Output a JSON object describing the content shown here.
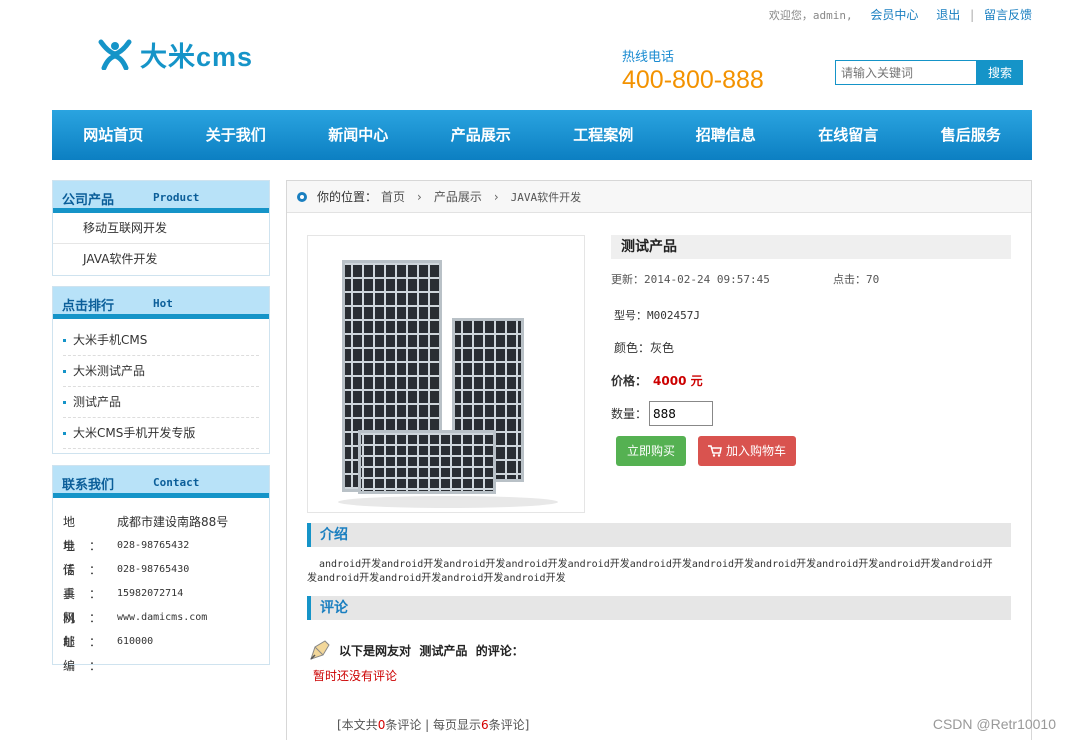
{
  "header": {
    "welcome": "欢迎您，admin,",
    "member_center": "会员中心",
    "logout": "退出",
    "separator": "|",
    "feedback": "留言反馈",
    "logo_text": "大米cms",
    "hotline_label": "热线电话",
    "hotline_number": "400-800-888",
    "search_placeholder": "请输入关键词",
    "search_button": "搜索"
  },
  "nav": [
    "网站首页",
    "关于我们",
    "新闻中心",
    "产品展示",
    "工程案例",
    "招聘信息",
    "在线留言",
    "售后服务"
  ],
  "sidebar": {
    "products": {
      "title_cn": "公司产品",
      "title_en": "Product",
      "items": [
        "移动互联网开发",
        "JAVA软件开发"
      ]
    },
    "hot": {
      "title_cn": "点击排行",
      "title_en": "Hot",
      "items": [
        "大米手机CMS",
        "大米测试产品",
        "测试产品",
        "大米CMS手机开发专版"
      ]
    },
    "contact": {
      "title_cn": "联系我们",
      "title_en": "Contact",
      "rows": [
        {
          "k": "地址：",
          "v": "成都市建设南路88号"
        },
        {
          "k": "电话：",
          "v": "028-98765432"
        },
        {
          "k": "传真：",
          "v": "028-98765430"
        },
        {
          "k": "手机：",
          "v": "15982072714"
        },
        {
          "k": "网址：",
          "v": "www.damicms.com"
        },
        {
          "k": "邮编：",
          "v": "610000"
        }
      ]
    }
  },
  "breadcrumb": {
    "label": "你的位置：",
    "home": "首页",
    "cat": "产品展示",
    "current": "JAVA软件开发",
    "arrow": "›"
  },
  "product": {
    "title": "测试产品",
    "updated": "更新：2014-02-24 09:57:45",
    "clicks": "点击：70",
    "model": "型号：M002457J",
    "color": "颜色：灰色",
    "price_label": "价格：",
    "price": "4000 元",
    "qty_label": "数量：",
    "qty_value": "888",
    "buy_button": "立即购买",
    "cart_button": "加入购物车"
  },
  "intro": {
    "title": "介绍",
    "text": "android开发android开发android开发android开发android开发android开发android开发android开发android开发android开发android开发android开发android开发android开发android开发"
  },
  "comments": {
    "title": "评论",
    "head_pre": "以下是网友对",
    "product": "测试产品",
    "head_post": "的评论：",
    "empty": "暂时还没有评论",
    "pager_1": "[本文共",
    "count": "0",
    "pager_2": "条评论 | 每页显示",
    "per_page": "6",
    "pager_3": "条评论]"
  },
  "watermark": "CSDN @Retr10010",
  "colors": {
    "brand": "#1594c8",
    "nav_top": "#2aa4e0",
    "nav_bottom": "#0c7fc2",
    "hotline": "#f39200",
    "price": "#cc0000",
    "buy": "#55b152",
    "cart": "#d9534f"
  }
}
